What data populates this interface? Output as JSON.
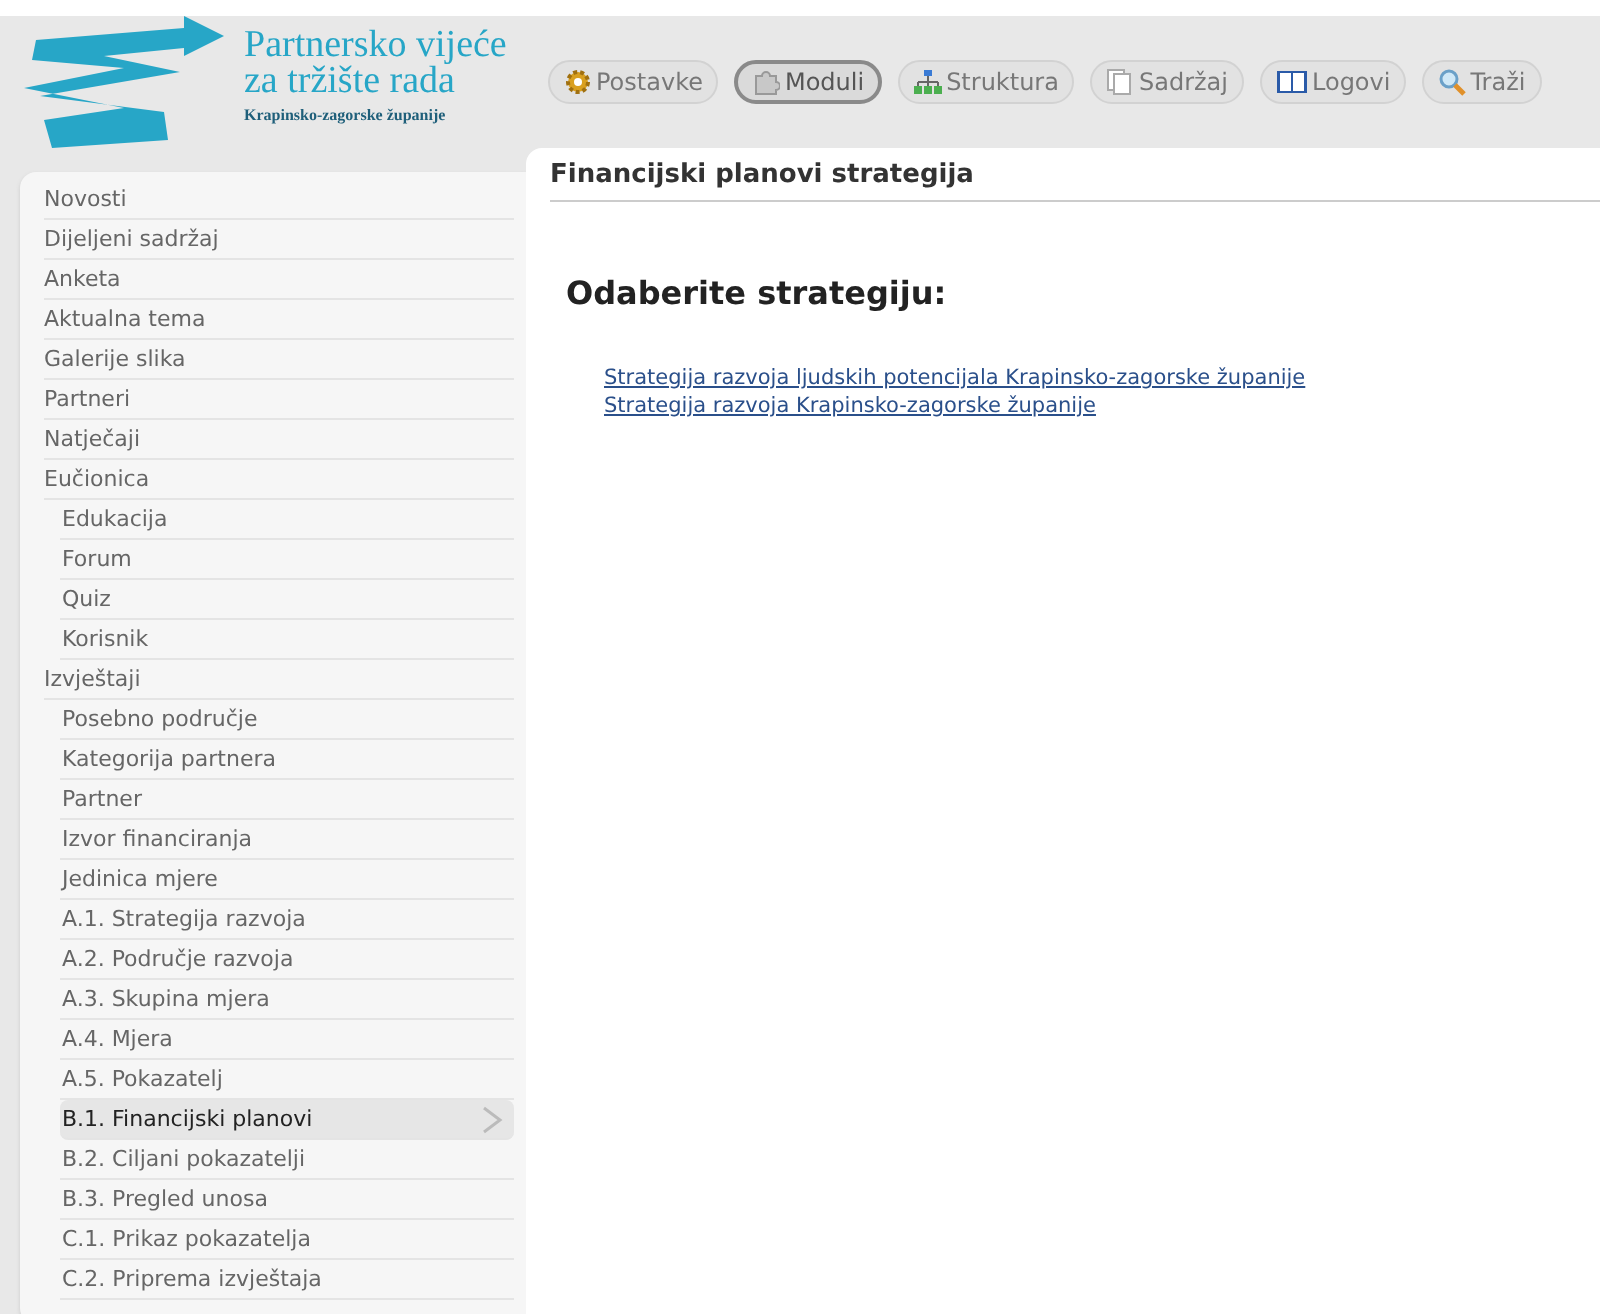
{
  "logo": {
    "title_line_1": "Partnersko vijeće",
    "title_line_2": "za tržište rada",
    "subtitle": "Krapinsko-zagorske županije"
  },
  "toolbar": [
    {
      "label": "Postavke",
      "kind": "gear",
      "selected": false
    },
    {
      "label": "Moduli",
      "kind": "puzzle",
      "selected": true
    },
    {
      "label": "Struktura",
      "kind": "tree",
      "selected": false
    },
    {
      "label": "Sadržaj",
      "kind": "pages",
      "selected": false
    },
    {
      "label": "Logovi",
      "kind": "book",
      "selected": false
    },
    {
      "label": "Traži",
      "kind": "search",
      "selected": false
    }
  ],
  "sidebar": {
    "items": [
      {
        "label": "Novosti",
        "selected": false
      },
      {
        "label": "Dijeljeni sadržaj",
        "selected": false
      },
      {
        "label": "Anketa",
        "selected": false
      },
      {
        "label": "Aktualna tema",
        "selected": false
      },
      {
        "label": "Galerije slika",
        "selected": false
      },
      {
        "label": "Partneri",
        "selected": false
      },
      {
        "label": "Natječaji",
        "selected": false
      },
      {
        "label": "Eučionica",
        "selected": false,
        "children": [
          {
            "label": "Edukacija",
            "selected": false
          },
          {
            "label": "Forum",
            "selected": false
          },
          {
            "label": "Quiz",
            "selected": false
          },
          {
            "label": "Korisnik",
            "selected": false
          }
        ]
      },
      {
        "label": "Izvještaji",
        "selected": false,
        "children": [
          {
            "label": "Posebno područje",
            "selected": false
          },
          {
            "label": "Kategorija partnera",
            "selected": false
          },
          {
            "label": "Partner",
            "selected": false
          },
          {
            "label": "Izvor financiranja",
            "selected": false
          },
          {
            "label": "Jedinica mjere",
            "selected": false
          },
          {
            "label": "A.1. Strategija razvoja",
            "selected": false
          },
          {
            "label": "A.2. Područje razvoja",
            "selected": false
          },
          {
            "label": "A.3. Skupina mjera",
            "selected": false
          },
          {
            "label": "A.4. Mjera",
            "selected": false
          },
          {
            "label": "A.5. Pokazatelj",
            "selected": false
          },
          {
            "label": "B.1. Financijski planovi",
            "selected": true
          },
          {
            "label": "B.2. Ciljani pokazatelji",
            "selected": false
          },
          {
            "label": "B.3. Pregled unosa",
            "selected": false
          },
          {
            "label": "C.1. Prikaz pokazatelja",
            "selected": false
          },
          {
            "label": "C.2. Priprema izvještaja",
            "selected": false
          }
        ]
      }
    ]
  },
  "main": {
    "title": "Financijski planovi strategija",
    "heading": "Odaberite strategiju:",
    "links": [
      "Strategija razvoja ljudskih potencijala Krapinsko-zagorske županije",
      "Strategija razvoja Krapinsko-zagorske županije"
    ]
  }
}
